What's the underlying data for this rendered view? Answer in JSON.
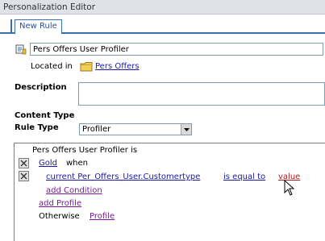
{
  "window": {
    "title": "Personalization Editor"
  },
  "tabs": [
    {
      "label": "New Rule"
    }
  ],
  "rule": {
    "name": "Pers Offers User Profiler"
  },
  "location": {
    "label": "Located in",
    "folder": "Pers Offers"
  },
  "description": {
    "label": "Description",
    "value": ""
  },
  "content_type": {
    "label": "Content Type"
  },
  "rule_type": {
    "label": "Rule Type",
    "selected": "Profiler"
  },
  "rule_body": {
    "header": "Pers Offers User Profiler is",
    "profile": "Gold",
    "when": "when",
    "condition": {
      "attribute": "current Per_Offers_User.Customertype",
      "operator": "is equal to",
      "value": "value"
    },
    "add_condition": "add Condition",
    "add_profile": "add Profile",
    "otherwise": "Otherwise",
    "otherwise_profile": "Profile"
  },
  "icons": {
    "rule": "rule-icon",
    "folder": "folder-icon",
    "delete": "delete-x-icon",
    "dropdown": "chevron-down-icon",
    "cursor": "mouse-pointer-icon"
  },
  "colors": {
    "tab_border": "#3b6fb3",
    "link": "#1a1aa6",
    "link_visited": "#7a1a9a",
    "link_value": "#b01818"
  }
}
